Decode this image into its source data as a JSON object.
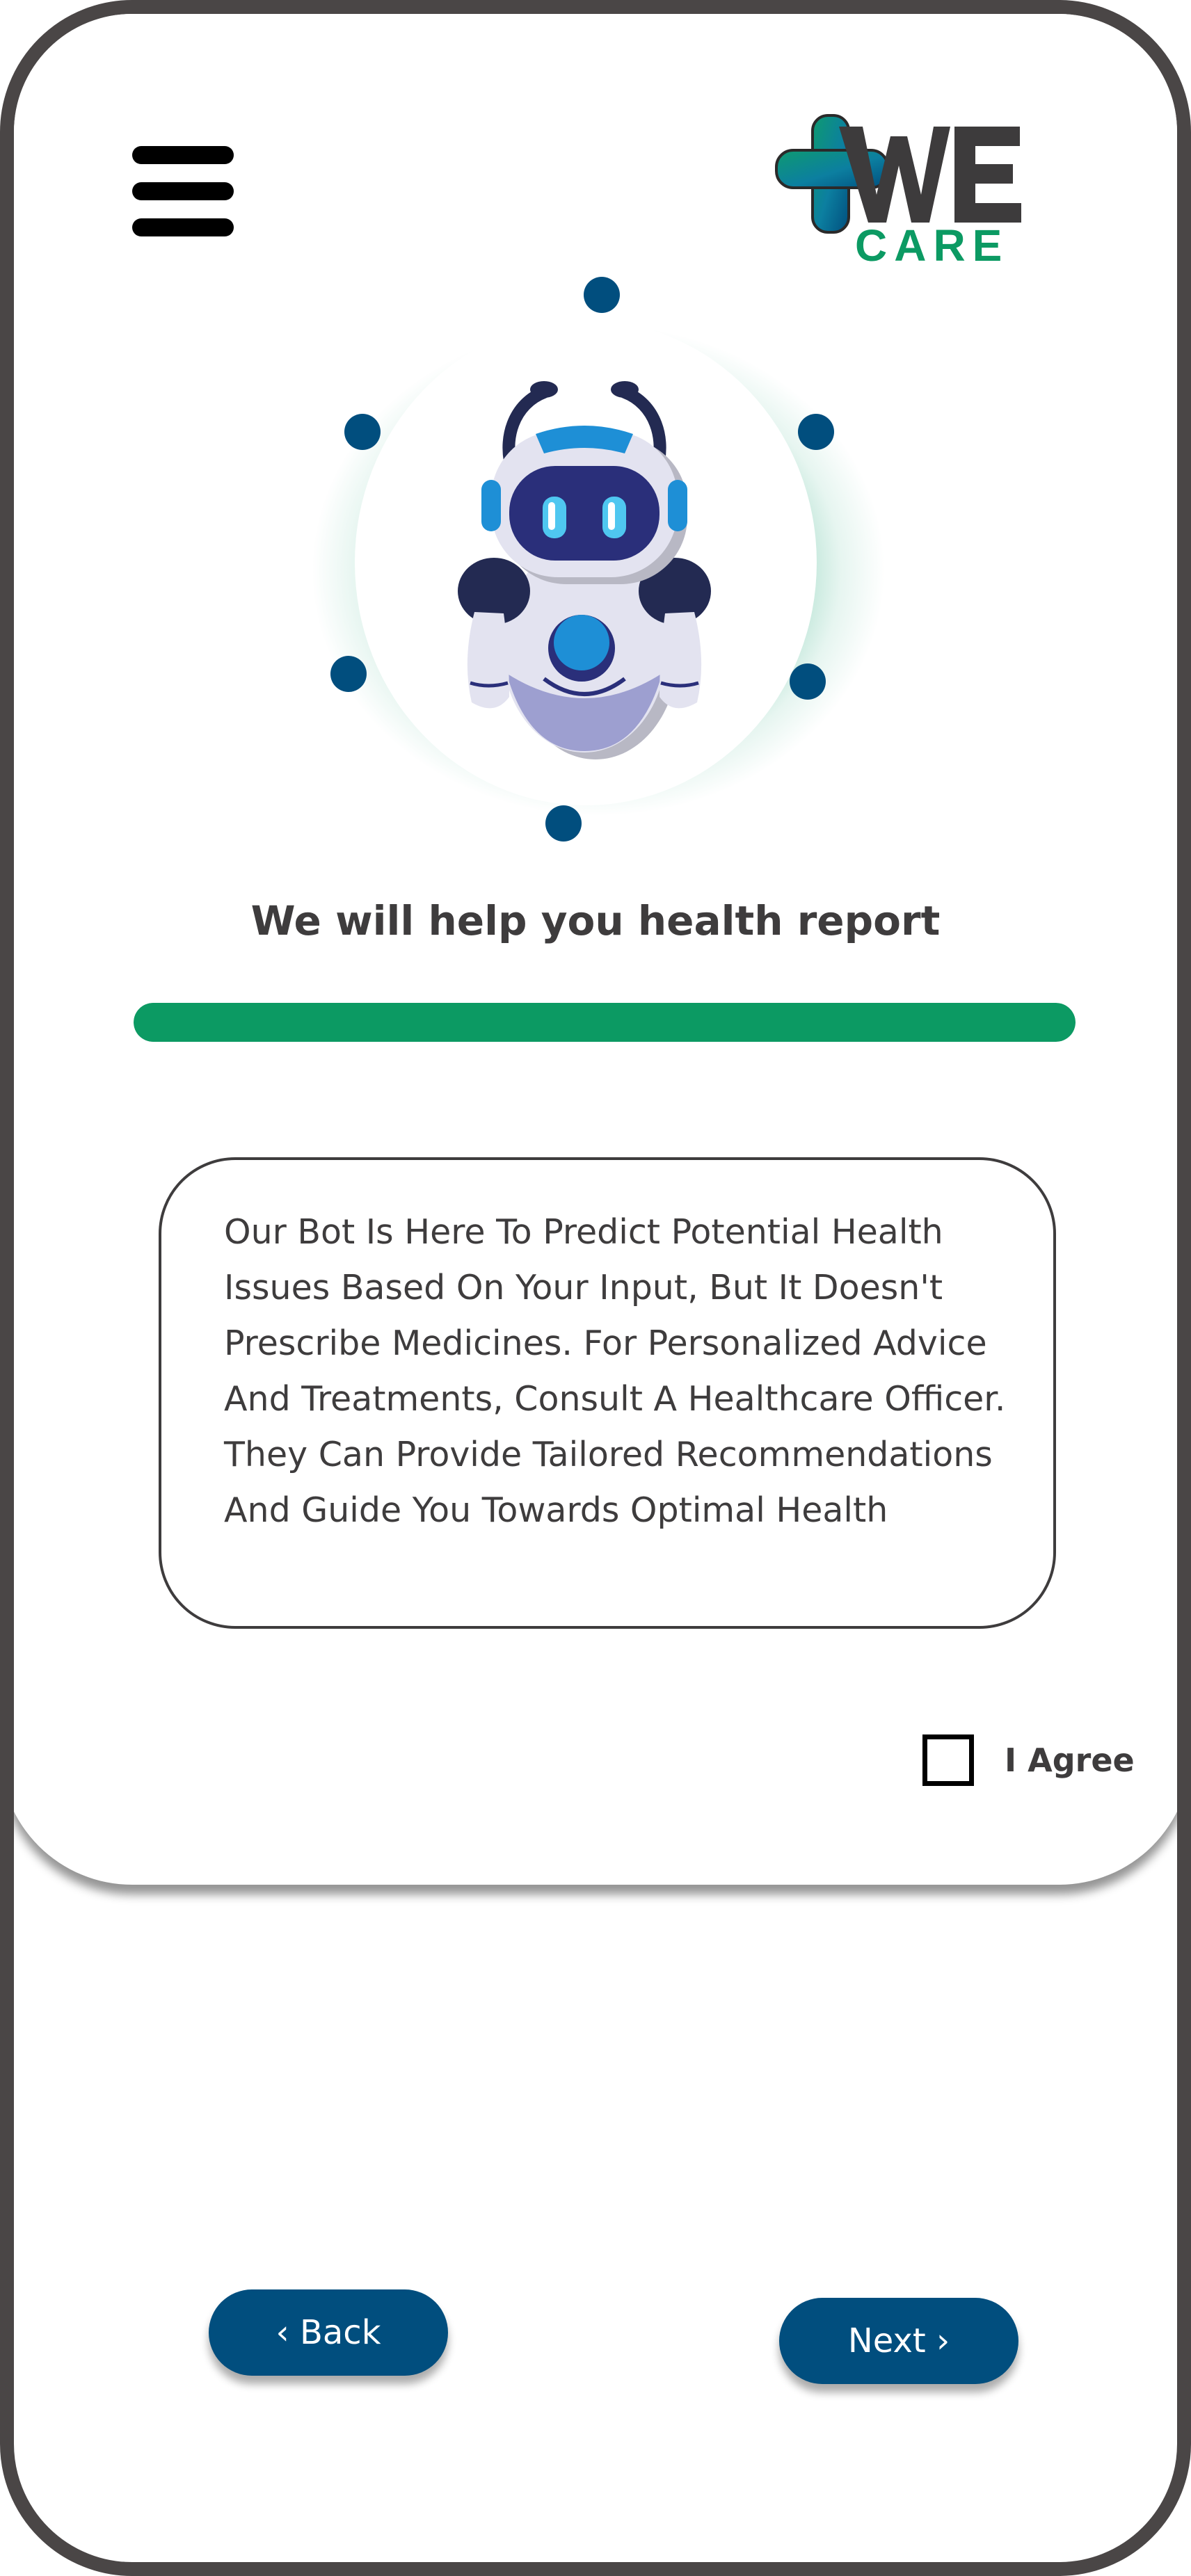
{
  "header": {
    "menu_icon": "hamburger-menu-icon",
    "logo": {
      "brand_we": "WE",
      "brand_care": "CARE",
      "accent_green": "#0c9a63",
      "accent_blue": "#014e7e"
    }
  },
  "hero": {
    "illustration": "robot-icon",
    "title": "We will help you health report"
  },
  "progress": {
    "value": 1.0,
    "fill_color": "#0c9a63"
  },
  "disclaimer": {
    "text": "Our Bot Is Here To Predict Potential Health Issues Based On Your Input, But It Doesn't Prescribe Medicines. For Personalized Advice And Treatments, Consult A Healthcare Officer. They Can Provide Tailored Recommendations And Guide You Towards Optimal Health"
  },
  "agreement": {
    "label": "I Agree",
    "checked": false
  },
  "navigation": {
    "back_label": "‹ Back",
    "next_label": "Next ›"
  },
  "colors": {
    "frame": "#4a4646",
    "text": "#3e3c3d",
    "primary_button": "#014e7e"
  }
}
